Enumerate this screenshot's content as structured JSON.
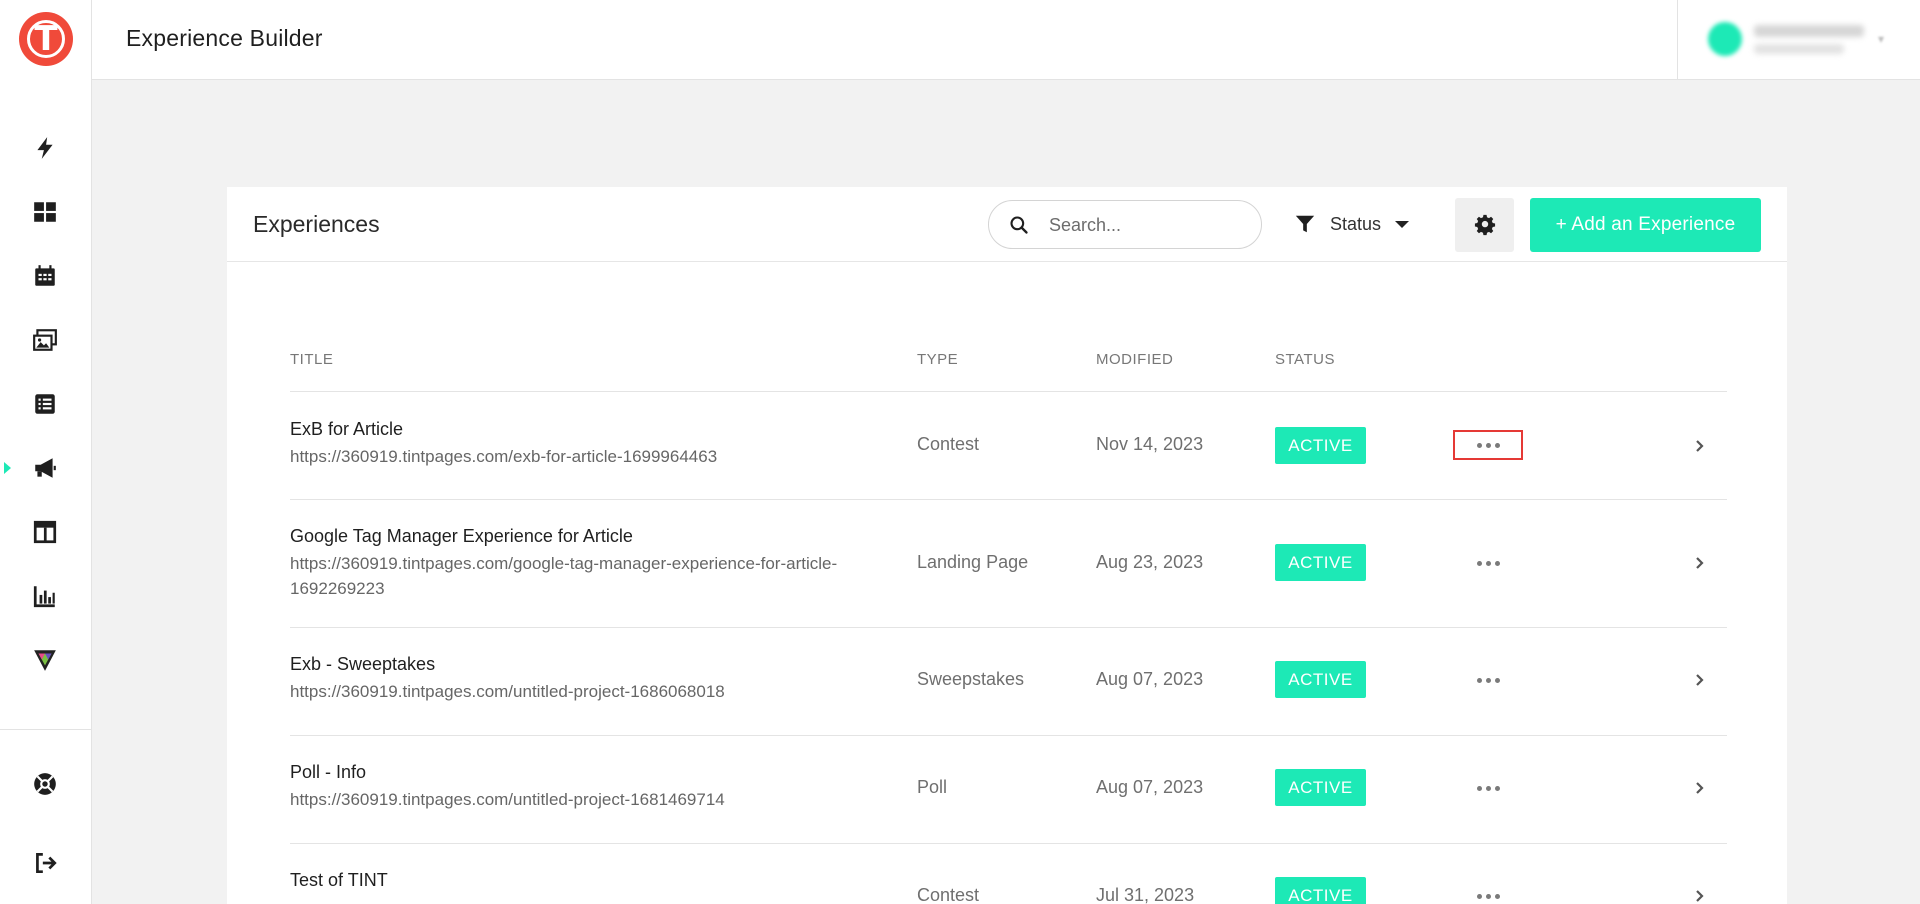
{
  "header": {
    "title": "Experience Builder"
  },
  "sidebar": {
    "logo_letter": "T",
    "items": [
      {
        "name": "lightning-icon"
      },
      {
        "name": "dashboard-grid-icon"
      },
      {
        "name": "calendar-icon"
      },
      {
        "name": "gallery-icon"
      },
      {
        "name": "list-icon"
      },
      {
        "name": "megaphone-icon",
        "active": true
      },
      {
        "name": "layout-icon"
      },
      {
        "name": "analytics-chart-icon"
      },
      {
        "name": "brand-triangle-icon"
      },
      {
        "name": "help-lifebuoy-icon"
      },
      {
        "name": "logout-icon"
      }
    ]
  },
  "colors": {
    "accent": "#1de9b6",
    "logo": "#f04a3a",
    "highlight": "#e53935"
  },
  "card": {
    "title": "Experiences",
    "search": {
      "placeholder": "Search..."
    },
    "filter_label": "Status",
    "add_label": "+ Add an Experience"
  },
  "table": {
    "columns": [
      "TITLE",
      "TYPE",
      "MODIFIED",
      "STATUS"
    ],
    "rows": [
      {
        "title": "ExB for Article",
        "url": "https://360919.tintpages.com/exb-for-article-1699964463",
        "type": "Contest",
        "modified": "Nov 14, 2023",
        "status": "ACTIVE"
      },
      {
        "title": "Google Tag Manager Experience for Article",
        "url": "https://360919.tintpages.com/google-tag-manager-experience-for-article-1692269223",
        "type": "Landing Page",
        "modified": "Aug 23, 2023",
        "status": "ACTIVE"
      },
      {
        "title": "Exb - Sweeptakes",
        "url": "https://360919.tintpages.com/untitled-project-1686068018",
        "type": "Sweepstakes",
        "modified": "Aug 07, 2023",
        "status": "ACTIVE"
      },
      {
        "title": "Poll - Info",
        "url": "https://360919.tintpages.com/untitled-project-1681469714",
        "type": "Poll",
        "modified": "Aug 07, 2023",
        "status": "ACTIVE"
      },
      {
        "title": "Test of TINT",
        "url": "",
        "type": "Contest",
        "modified": "Jul 31, 2023",
        "status": "ACTIVE"
      }
    ]
  }
}
